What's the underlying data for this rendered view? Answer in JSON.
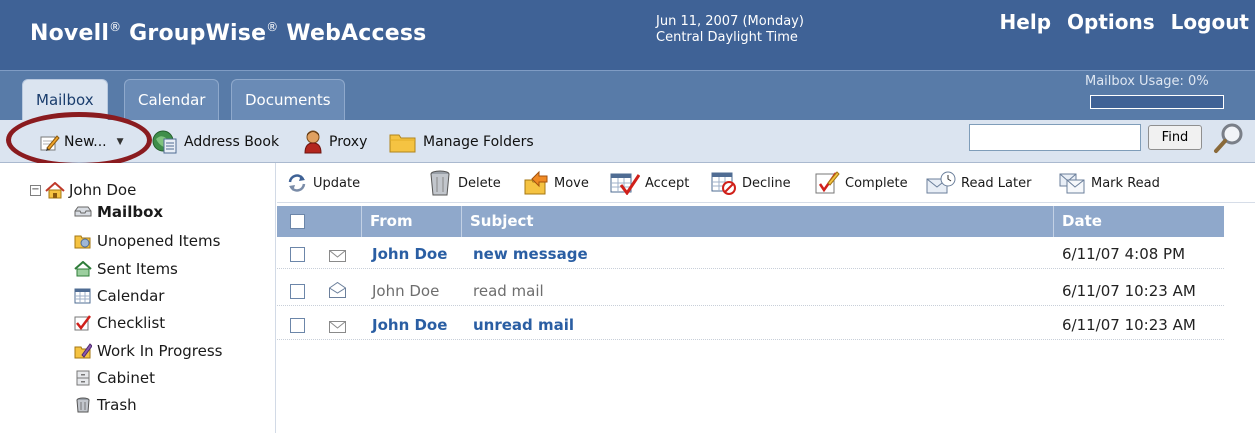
{
  "app": {
    "brand_novell": "Novell",
    "brand_groupwise": " GroupWise",
    "brand_webaccess": " WebAccess",
    "registered": "®"
  },
  "header": {
    "date": "Jun 11, 2007 (Monday)",
    "timezone": "Central Daylight Time",
    "links": {
      "help": "Help",
      "options": "Options",
      "logout": "Logout"
    }
  },
  "tabs": [
    {
      "label": "Mailbox",
      "active": true
    },
    {
      "label": "Calendar",
      "active": false
    },
    {
      "label": "Documents",
      "active": false
    }
  ],
  "mailbox_usage": {
    "label": "Mailbox Usage: 0%",
    "percent": 0
  },
  "toolbar": {
    "new_label": "New...",
    "address_book_label": "Address Book",
    "proxy_label": "Proxy",
    "manage_folders_label": "Manage Folders",
    "search_value": "",
    "find_label": "Find"
  },
  "sidebar": {
    "user": "John Doe",
    "toggle": "−",
    "folders": [
      {
        "label": "Mailbox",
        "icon": "mailbox-icon",
        "active": true
      },
      {
        "label": "Unopened Items",
        "icon": "unopened-items-icon"
      },
      {
        "label": "Sent Items",
        "icon": "sent-items-icon"
      },
      {
        "label": "Calendar",
        "icon": "calendar-icon"
      },
      {
        "label": "Checklist",
        "icon": "checklist-icon"
      },
      {
        "label": "Work In Progress",
        "icon": "work-in-progress-icon"
      },
      {
        "label": "Cabinet",
        "icon": "cabinet-icon"
      },
      {
        "label": "Trash",
        "icon": "trash-icon"
      }
    ]
  },
  "actions": {
    "update": "Update",
    "delete": "Delete",
    "move": "Move",
    "accept": "Accept",
    "decline": "Decline",
    "complete": "Complete",
    "read_later": "Read Later",
    "mark_read": "Mark Read"
  },
  "list": {
    "columns": {
      "from": "From",
      "subject": "Subject",
      "date": "Date"
    },
    "rows": [
      {
        "from": "John Doe",
        "subject": "new message",
        "date": "6/11/07 4:08 PM",
        "status": "unread"
      },
      {
        "from": "John Doe",
        "subject": "read mail",
        "date": "6/11/07 10:23 AM",
        "status": "read"
      },
      {
        "from": "John Doe",
        "subject": "unread mail",
        "date": "6/11/07 10:23 AM",
        "status": "unread"
      }
    ]
  },
  "colors": {
    "header_bg": "#3f6296",
    "tab_band_bg": "#587ba8",
    "toolbar_bg": "#dbe4f0",
    "list_header_bg": "#8fa8cb",
    "unread_text": "#2a5ea3",
    "highlight_ring": "#8a1b1f"
  }
}
